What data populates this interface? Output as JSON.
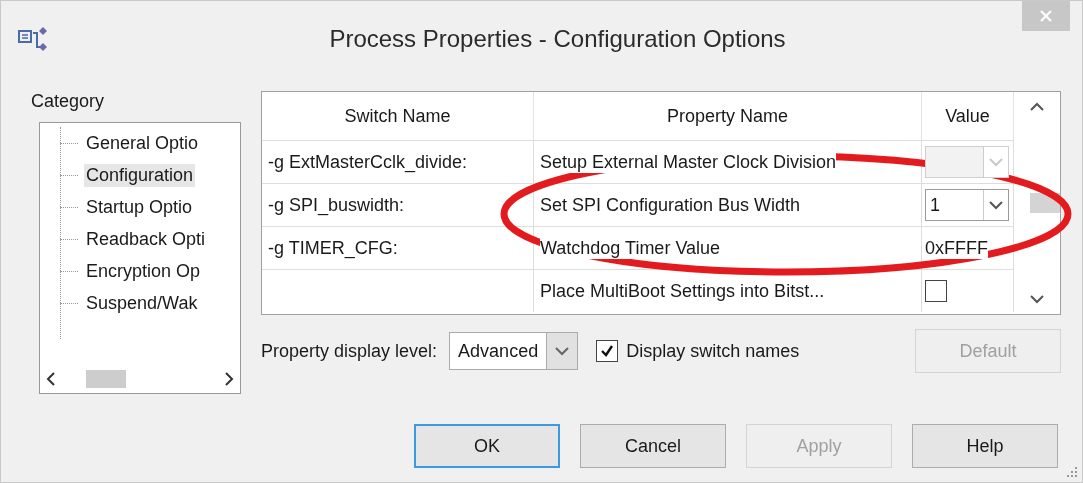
{
  "window": {
    "title": "Process Properties - Configuration Options"
  },
  "category": {
    "label": "Category",
    "items": [
      {
        "label": "General Optio",
        "selected": false
      },
      {
        "label": "Configuration",
        "selected": true
      },
      {
        "label": "Startup Optio",
        "selected": false
      },
      {
        "label": "Readback Opti",
        "selected": false
      },
      {
        "label": "Encryption Op",
        "selected": false
      },
      {
        "label": "Suspend/Wak",
        "selected": false
      }
    ]
  },
  "table": {
    "columns": [
      "Switch Name",
      "Property Name",
      "Value"
    ],
    "rows": [
      {
        "switch": "-g ExtMasterCclk_divide:",
        "property": "Setup External Master Clock Division",
        "value": {
          "kind": "dropdown",
          "disabled": true
        }
      },
      {
        "switch": "-g SPI_buswidth:",
        "property": "Set SPI Configuration Bus Width",
        "value": {
          "kind": "dropdown",
          "text": "1",
          "disabled": false
        }
      },
      {
        "switch": "-g TIMER_CFG:",
        "property": "Watchdog Timer Value",
        "value": {
          "kind": "text",
          "text": "0xFFFF"
        }
      },
      {
        "property": "Place MultiBoot Settings into Bitst...",
        "value": {
          "kind": "checkbox",
          "checked": false
        }
      }
    ]
  },
  "display_level": {
    "label": "Property display level:",
    "value": "Advanced"
  },
  "display_switch_names": {
    "label": "Display switch names",
    "checked": true
  },
  "default_button": {
    "label": "Default",
    "disabled": true
  },
  "buttons": [
    {
      "label": "OK",
      "default": true,
      "disabled": false
    },
    {
      "label": "Cancel",
      "default": false,
      "disabled": false
    },
    {
      "label": "Apply",
      "default": false,
      "disabled": true
    },
    {
      "label": "Help",
      "default": false,
      "disabled": false
    }
  ],
  "annotation": {
    "kind": "ellipse"
  }
}
